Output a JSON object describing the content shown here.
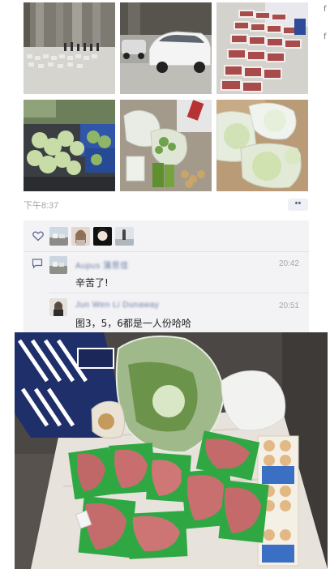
{
  "post": {
    "time_label": "下午8:37",
    "more_glyph": "••",
    "right_edge_glyphs": [
      "f",
      "f"
    ],
    "grid_photos": [
      {
        "icon": "crowd-plaza-photo"
      },
      {
        "icon": "parked-cars-photo"
      },
      {
        "icon": "meat-trays-photo"
      },
      {
        "icon": "vegetable-crates-photo"
      },
      {
        "icon": "vegetable-bags-photo"
      },
      {
        "icon": "cabbage-bags-photo"
      }
    ]
  },
  "feedback": {
    "likes_icon": "heart-icon",
    "like_avatars": [
      "avatar-1",
      "avatar-2",
      "avatar-3",
      "avatar-4"
    ],
    "comments": [
      {
        "name": "Aupus 蒲思佳",
        "time": "20:42",
        "text": "辛苦了!"
      },
      {
        "name": "Jun Wen Li Dunaway",
        "time": "20:51",
        "text": "图3，5，6都是一人份哈哈"
      }
    ]
  },
  "bottom_photo": {
    "icon": "groceries-table-photo"
  }
}
